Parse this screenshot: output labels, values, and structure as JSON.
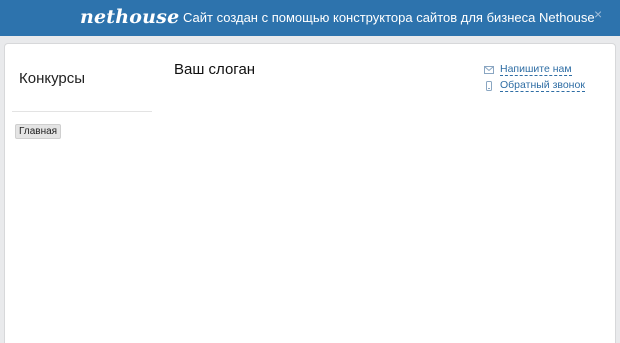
{
  "banner": {
    "logo": "nethouse",
    "text": "Сайт создан с помощью конструктора сайтов для бизнеса Nethouse",
    "close": "×",
    "bg_color": "#2d73ad"
  },
  "site": {
    "name": "Конкурсы",
    "slogan": "Ваш слоган",
    "nav": [
      {
        "label": "Главная"
      }
    ],
    "contacts": [
      {
        "label": "Напишите нам",
        "icon": "envelope-icon"
      },
      {
        "label": "Обратный звонок",
        "icon": "phone-icon"
      }
    ]
  },
  "colors": {
    "link": "#2e6da4",
    "page_bg": "#e9eaec"
  }
}
